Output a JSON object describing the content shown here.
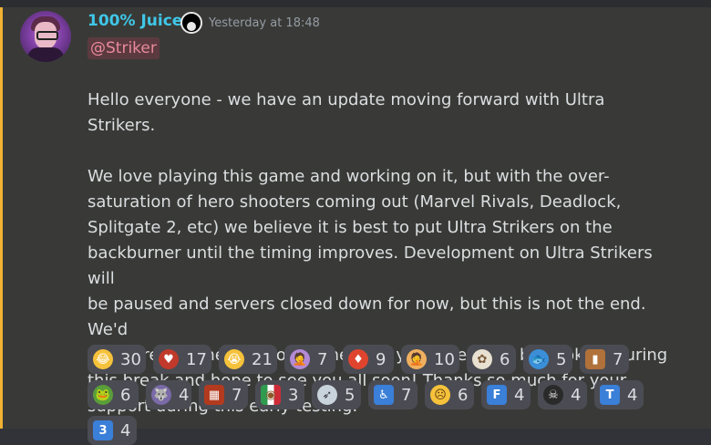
{
  "message": {
    "username": "100% Juice",
    "timestamp": "Yesterday at 18:48",
    "mention": "@Striker",
    "paragraphs": [
      "Hello everyone - we have an update moving forward with Ultra Strikers.",
      "We love playing this game and working on it, but with the over-\nsaturation of hero shooters coming out (Marvel Rivals, Deadlock,\nSplitgate 2, etc) we believe it is best to put Ultra Strikers on the\nbackburner until the timing improves. Development on Ultra Strikers will\nbe paused and servers closed down for now, but this is not the end. We'd\nlike to revisit the title sometime next year. We'll still be cooking during\nthis break and hope to see you all soon! Thanks so much for your\nsupport during this early testing."
    ]
  },
  "reactions": [
    {
      "emoji": "rofl-emoji",
      "glyph": "😂",
      "count": "30",
      "color": "#f6c23b"
    },
    {
      "emoji": "cyclops-heart-emoji",
      "glyph": "♥",
      "count": "17",
      "color": "#c0392b"
    },
    {
      "emoji": "sob-emoji",
      "glyph": "😭",
      "count": "21",
      "color": "#f6c23b"
    },
    {
      "emoji": "facepalm-emoji",
      "glyph": "🤦",
      "count": "7",
      "color": "#b38ad6"
    },
    {
      "emoji": "heart-badge-emoji",
      "glyph": "♦",
      "count": "9",
      "color": "#e0442e"
    },
    {
      "emoji": "person-facepalm-emoji",
      "glyph": "🤦",
      "count": "10",
      "color": "#f0b060"
    },
    {
      "emoji": "sparkle-flower-emoji",
      "glyph": "✿",
      "count": "6",
      "color": "#e8e0d0"
    },
    {
      "emoji": "fish-emoji",
      "glyph": "🐟",
      "count": "5",
      "color": "#3b8fd8"
    },
    {
      "emoji": "ultra-logo-emoji",
      "glyph": "▮",
      "count": "7",
      "color": "#b0713a"
    },
    {
      "emoji": "pepe-emoji",
      "glyph": "🐸",
      "count": "6",
      "color": "#5a9e3a"
    },
    {
      "emoji": "wolf-emoji",
      "glyph": "🐺",
      "count": "4",
      "color": "#7a6aa8"
    },
    {
      "emoji": "red-grid-emoji",
      "glyph": "▦",
      "count": "7",
      "color": "#b33a1e"
    },
    {
      "emoji": "mexico-flag-emoji",
      "glyph": "◉",
      "count": "3",
      "color": "#2e9b4f"
    },
    {
      "emoji": "rocket-emoji",
      "glyph": "➶",
      "count": "5",
      "color": "#c9d3dc"
    },
    {
      "emoji": "accessibility-emoji",
      "glyph": "♿",
      "count": "7",
      "color": "#3a7fd8"
    },
    {
      "emoji": "sad-face-emoji",
      "glyph": "☹",
      "count": "6",
      "color": "#f6c23b"
    },
    {
      "emoji": "letter-f-emoji",
      "glyph": "F",
      "count": "4",
      "color": "#3a7fd8"
    },
    {
      "emoji": "skull-emoji",
      "glyph": "☠",
      "count": "4",
      "color": "#2a2a2a"
    },
    {
      "emoji": "letter-t-emoji",
      "glyph": "T",
      "count": "4",
      "color": "#3a7fd8"
    },
    {
      "emoji": "keycap-3-emoji",
      "glyph": "3",
      "count": "4",
      "color": "#3a7fd8"
    }
  ]
}
